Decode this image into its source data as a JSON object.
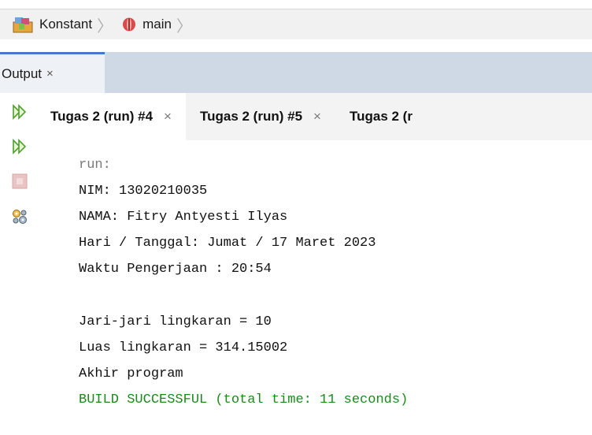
{
  "breadcrumb": {
    "project": "Konstant",
    "branch": "main"
  },
  "output_panel": {
    "title": "Output",
    "close": "×"
  },
  "toolbar": {
    "items": [
      "rerun-icon",
      "rerun-with-params-icon",
      "stop-icon",
      "settings-icon"
    ]
  },
  "tabs": [
    {
      "label": "Tugas 2 (run) #4",
      "close": "×"
    },
    {
      "label": "Tugas 2 (run) #5",
      "close": "×"
    },
    {
      "label": "Tugas 2 (r",
      "close": ""
    }
  ],
  "console": {
    "run": "run:",
    "nim": "NIM: 13020210035",
    "nama": "NAMA: Fitry Antyesti Ilyas",
    "hari": "Hari / Tanggal: Jumat / 17 Maret 2023",
    "waktu": "Waktu Pengerjaan : 20:54",
    "jari": "Jari-jari lingkaran = 10",
    "luas": "Luas lingkaran = 314.15002",
    "akhir": "Akhir program",
    "build": "BUILD SUCCESSFUL (total time: 11 seconds)"
  },
  "colors": {
    "accent": "#4876c8",
    "build_success": "#1a8a1a",
    "run_text": "#7a7a7a"
  }
}
